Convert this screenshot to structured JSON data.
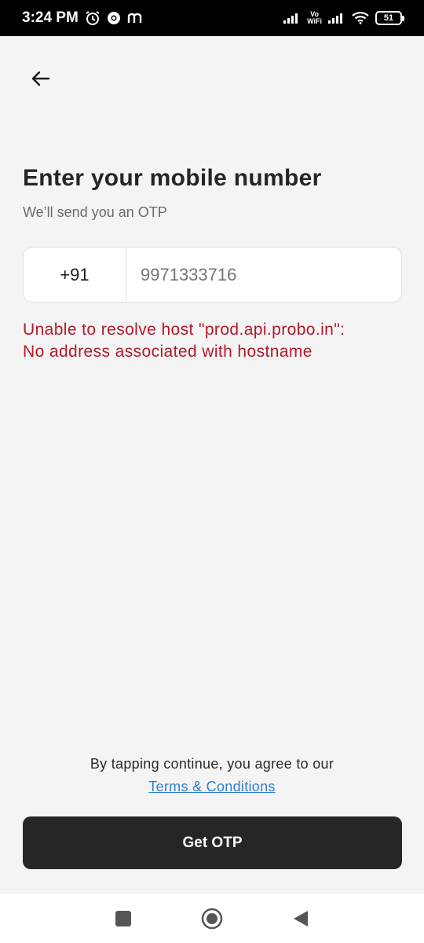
{
  "status_bar": {
    "time": "3:24 PM",
    "vowifi_line1": "Vo",
    "vowifi_line2": "WiFi",
    "battery": "51",
    "icons": [
      "alarm-icon",
      "chrome-icon",
      "m-app-icon",
      "signal-icon",
      "vowifi-icon",
      "signal-icon",
      "wifi-icon",
      "battery-icon"
    ]
  },
  "header": {
    "back_icon": "arrow-left-icon"
  },
  "main": {
    "title": "Enter your mobile number",
    "subtitle": "We’ll send you an OTP",
    "country_code": "+91",
    "phone_value": "9971333716",
    "error_line1": "Unable to resolve host \"prod.api.probo.in\":",
    "error_line2": "No address associated with hostname"
  },
  "footer": {
    "terms_text": "By tapping continue, you agree to our",
    "terms_link": "Terms & Conditions",
    "button_label": "Get OTP"
  },
  "nav_bar": {
    "icons": [
      "recents-icon",
      "home-icon",
      "back-icon"
    ]
  },
  "colors": {
    "background": "#f4f4f4",
    "error": "#b3192b",
    "link": "#2f7fd1",
    "button": "#262626"
  }
}
